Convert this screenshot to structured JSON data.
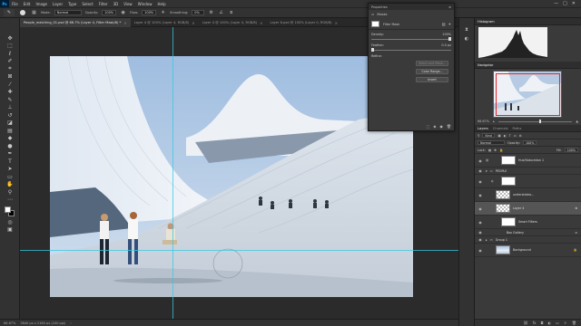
{
  "app": {
    "logo": "Ps"
  },
  "menu": [
    "File",
    "Edit",
    "Image",
    "Layer",
    "Type",
    "Select",
    "Filter",
    "3D",
    "View",
    "Window",
    "Help"
  ],
  "window_controls": [
    "—",
    "□",
    "✕"
  ],
  "options_bar": {
    "mode_label": "Mode:",
    "mode_value": "Normal",
    "opacity_label": "Opacity:",
    "opacity_value": "100%",
    "flow_label": "Flow:",
    "flow_value": "100%",
    "smoothing_label": "Smoothing:",
    "smoothing_value": "0%"
  },
  "tabs": [
    {
      "label": "People_matching_01.psd @ 66.7% (Layer 4, Filter Mask/8) *",
      "active": true
    },
    {
      "label": "Layer 4 @ 100% (Layer 4, RGB/8)",
      "active": false
    },
    {
      "label": "Layer 4 @ 100% (Layer 4, RGB/8)",
      "active": false
    },
    {
      "label": "Layer 6.psd @ 100% (Layer 0, RGB/8)",
      "active": false
    }
  ],
  "status": {
    "zoom": "66.67%",
    "doc": "3840 px x 2160 px (240 ppi)"
  },
  "properties": {
    "title": "Properties",
    "tab_label": "Masks",
    "mask_label": "Filter Mask",
    "density_label": "Density:",
    "density_value": "100%",
    "density_level": 1.0,
    "feather_label": "Feather:",
    "feather_value": "0.0 px",
    "feather_level": 0.0,
    "refine_label": "Refine:",
    "btn_select_mask": "Select and Mask...",
    "btn_color_range": "Color Range...",
    "btn_invert": "Invert"
  },
  "right": {
    "histogram_tab": "Histogram",
    "navigator_tab": "Navigator",
    "nav_zoom": "66.67%",
    "layer_tabs": [
      "Layers",
      "Channels",
      "Paths"
    ],
    "kind_label": "Kind",
    "blend_mode": "Normal",
    "opacity_label": "Opacity:",
    "opacity_value": "100%",
    "lock_label": "Lock:",
    "fill_label": "Fill:",
    "fill_value": "100%"
  },
  "layers": [
    {
      "name": "Hue/Saturation 1",
      "type": "adjust",
      "visible": true,
      "small": false
    },
    {
      "name": "PEOPLE",
      "type": "group",
      "visible": true,
      "small": true
    },
    {
      "name": "",
      "type": "adjust",
      "visible": true,
      "small": false
    },
    {
      "name": "understateo...",
      "type": "checker",
      "visible": true,
      "small": false
    },
    {
      "name": "Layer 4",
      "type": "checker",
      "visible": true,
      "small": false,
      "selected": true
    },
    {
      "name": "Smart Filters",
      "type": "filtermask",
      "visible": true,
      "small": false
    },
    {
      "name": "Box Gallery",
      "type": "filter",
      "visible": true,
      "small": true
    },
    {
      "name": "Group 1",
      "type": "group",
      "visible": true,
      "small": true
    },
    {
      "name": "Background",
      "type": "photo",
      "visible": true,
      "small": false
    }
  ]
}
